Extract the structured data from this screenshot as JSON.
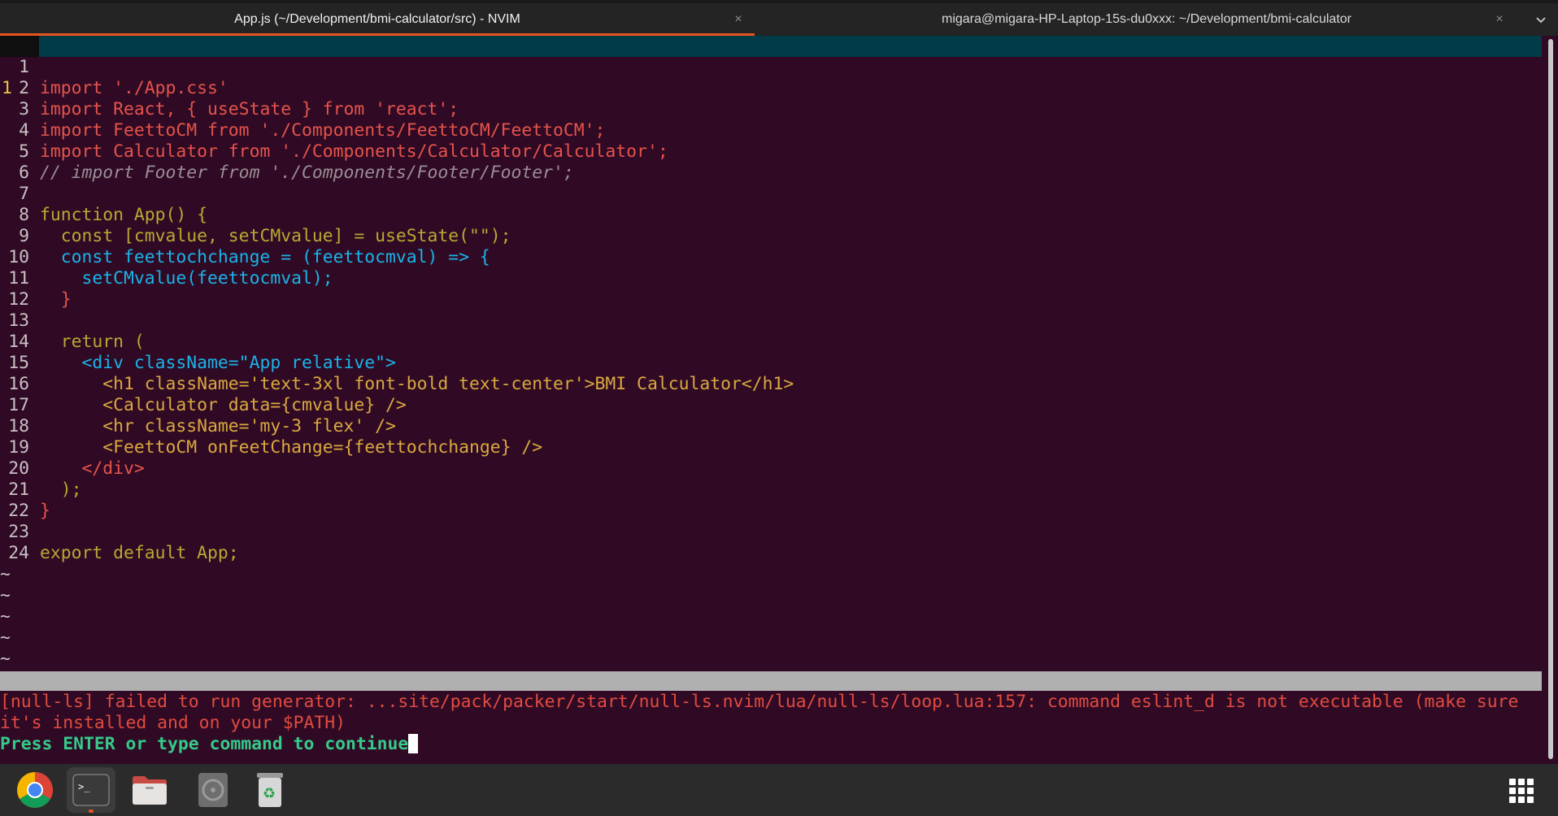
{
  "tabs": [
    {
      "label": "App.js (~/Development/bmi-calculator/src) - NVIM",
      "close": "×"
    },
    {
      "label": "migara@migara-HP-Laptop-15s-du0xxx: ~/Development/bmi-calculator",
      "close": "×"
    }
  ],
  "tab_dropdown": "⌄",
  "editor": {
    "current_line_number": "1",
    "current_line_code": "import React, { useState } from 'react';",
    "lines": [
      {
        "n": "1",
        "code": ""
      },
      {
        "n": "2",
        "code": "import './App.css'"
      },
      {
        "n": "3",
        "code": ""
      },
      {
        "n": "4",
        "code": "import FeettoCM from './Components/FeettoCM/FeettoCM';"
      },
      {
        "n": "5",
        "code": "import Calculator from './Components/Calculator/Calculator';"
      },
      {
        "n": "6",
        "code": "// import Footer from './Components/Footer/Footer';"
      },
      {
        "n": "7",
        "code": ""
      },
      {
        "n": "8",
        "code": "function App() {"
      },
      {
        "n": "9",
        "code": "  const [cmvalue, setCMvalue] = useState(\"\");"
      },
      {
        "n": "10",
        "code": "  const feettochchange = (feettocmval) => {"
      },
      {
        "n": "11",
        "code": "    setCMvalue(feettocmval);"
      },
      {
        "n": "12",
        "code": "  }"
      },
      {
        "n": "13",
        "code": ""
      },
      {
        "n": "14",
        "code": "  return ("
      },
      {
        "n": "15",
        "code": "    <div className=\"App relative\">"
      },
      {
        "n": "16",
        "code": "      <h1 className='text-3xl font-bold text-center'>BMI Calculator</h1>"
      },
      {
        "n": "17",
        "code": "      <Calculator data={cmvalue} />"
      },
      {
        "n": "18",
        "code": "      <hr className='my-3 flex' />"
      },
      {
        "n": "19",
        "code": "      <FeettoCM onFeetChange={feettochchange} />"
      },
      {
        "n": "20",
        "code": "    </div>"
      },
      {
        "n": "21",
        "code": "  );"
      },
      {
        "n": "22",
        "code": "}"
      },
      {
        "n": "23",
        "code": ""
      },
      {
        "n": "24",
        "code": "export default App;"
      }
    ],
    "tilde": "~"
  },
  "messages": {
    "error_line1": "[null-ls] failed to run generator: ...site/pack/packer/start/null-ls.nvim/lua/null-ls/loop.lua:157: command eslint_d is not executable (make sure",
    "error_line2": "it's installed and on your $PATH)",
    "prompt": "Press ENTER or type command to continue"
  },
  "dock": {
    "items": [
      "chrome-icon",
      "terminal-icon",
      "files-icon",
      "disc-icon",
      "trash-icon"
    ],
    "terminal_prompt": ">_"
  },
  "colors": {
    "accent": "#e95420",
    "background": "#300a24",
    "cursorline": "#003b47"
  }
}
